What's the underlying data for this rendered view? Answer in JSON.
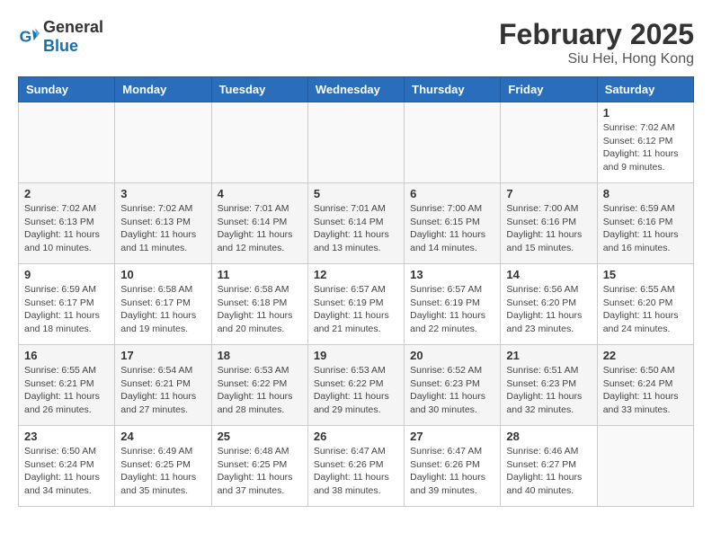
{
  "header": {
    "logo_general": "General",
    "logo_blue": "Blue",
    "month_year": "February 2025",
    "location": "Siu Hei, Hong Kong"
  },
  "days_of_week": [
    "Sunday",
    "Monday",
    "Tuesday",
    "Wednesday",
    "Thursday",
    "Friday",
    "Saturday"
  ],
  "weeks": [
    [
      {
        "day": "",
        "info": ""
      },
      {
        "day": "",
        "info": ""
      },
      {
        "day": "",
        "info": ""
      },
      {
        "day": "",
        "info": ""
      },
      {
        "day": "",
        "info": ""
      },
      {
        "day": "",
        "info": ""
      },
      {
        "day": "1",
        "info": "Sunrise: 7:02 AM\nSunset: 6:12 PM\nDaylight: 11 hours\nand 9 minutes."
      }
    ],
    [
      {
        "day": "2",
        "info": "Sunrise: 7:02 AM\nSunset: 6:13 PM\nDaylight: 11 hours\nand 10 minutes."
      },
      {
        "day": "3",
        "info": "Sunrise: 7:02 AM\nSunset: 6:13 PM\nDaylight: 11 hours\nand 11 minutes."
      },
      {
        "day": "4",
        "info": "Sunrise: 7:01 AM\nSunset: 6:14 PM\nDaylight: 11 hours\nand 12 minutes."
      },
      {
        "day": "5",
        "info": "Sunrise: 7:01 AM\nSunset: 6:14 PM\nDaylight: 11 hours\nand 13 minutes."
      },
      {
        "day": "6",
        "info": "Sunrise: 7:00 AM\nSunset: 6:15 PM\nDaylight: 11 hours\nand 14 minutes."
      },
      {
        "day": "7",
        "info": "Sunrise: 7:00 AM\nSunset: 6:16 PM\nDaylight: 11 hours\nand 15 minutes."
      },
      {
        "day": "8",
        "info": "Sunrise: 6:59 AM\nSunset: 6:16 PM\nDaylight: 11 hours\nand 16 minutes."
      }
    ],
    [
      {
        "day": "9",
        "info": "Sunrise: 6:59 AM\nSunset: 6:17 PM\nDaylight: 11 hours\nand 18 minutes."
      },
      {
        "day": "10",
        "info": "Sunrise: 6:58 AM\nSunset: 6:17 PM\nDaylight: 11 hours\nand 19 minutes."
      },
      {
        "day": "11",
        "info": "Sunrise: 6:58 AM\nSunset: 6:18 PM\nDaylight: 11 hours\nand 20 minutes."
      },
      {
        "day": "12",
        "info": "Sunrise: 6:57 AM\nSunset: 6:19 PM\nDaylight: 11 hours\nand 21 minutes."
      },
      {
        "day": "13",
        "info": "Sunrise: 6:57 AM\nSunset: 6:19 PM\nDaylight: 11 hours\nand 22 minutes."
      },
      {
        "day": "14",
        "info": "Sunrise: 6:56 AM\nSunset: 6:20 PM\nDaylight: 11 hours\nand 23 minutes."
      },
      {
        "day": "15",
        "info": "Sunrise: 6:55 AM\nSunset: 6:20 PM\nDaylight: 11 hours\nand 24 minutes."
      }
    ],
    [
      {
        "day": "16",
        "info": "Sunrise: 6:55 AM\nSunset: 6:21 PM\nDaylight: 11 hours\nand 26 minutes."
      },
      {
        "day": "17",
        "info": "Sunrise: 6:54 AM\nSunset: 6:21 PM\nDaylight: 11 hours\nand 27 minutes."
      },
      {
        "day": "18",
        "info": "Sunrise: 6:53 AM\nSunset: 6:22 PM\nDaylight: 11 hours\nand 28 minutes."
      },
      {
        "day": "19",
        "info": "Sunrise: 6:53 AM\nSunset: 6:22 PM\nDaylight: 11 hours\nand 29 minutes."
      },
      {
        "day": "20",
        "info": "Sunrise: 6:52 AM\nSunset: 6:23 PM\nDaylight: 11 hours\nand 30 minutes."
      },
      {
        "day": "21",
        "info": "Sunrise: 6:51 AM\nSunset: 6:23 PM\nDaylight: 11 hours\nand 32 minutes."
      },
      {
        "day": "22",
        "info": "Sunrise: 6:50 AM\nSunset: 6:24 PM\nDaylight: 11 hours\nand 33 minutes."
      }
    ],
    [
      {
        "day": "23",
        "info": "Sunrise: 6:50 AM\nSunset: 6:24 PM\nDaylight: 11 hours\nand 34 minutes."
      },
      {
        "day": "24",
        "info": "Sunrise: 6:49 AM\nSunset: 6:25 PM\nDaylight: 11 hours\nand 35 minutes."
      },
      {
        "day": "25",
        "info": "Sunrise: 6:48 AM\nSunset: 6:25 PM\nDaylight: 11 hours\nand 37 minutes."
      },
      {
        "day": "26",
        "info": "Sunrise: 6:47 AM\nSunset: 6:26 PM\nDaylight: 11 hours\nand 38 minutes."
      },
      {
        "day": "27",
        "info": "Sunrise: 6:47 AM\nSunset: 6:26 PM\nDaylight: 11 hours\nand 39 minutes."
      },
      {
        "day": "28",
        "info": "Sunrise: 6:46 AM\nSunset: 6:27 PM\nDaylight: 11 hours\nand 40 minutes."
      },
      {
        "day": "",
        "info": ""
      }
    ]
  ]
}
